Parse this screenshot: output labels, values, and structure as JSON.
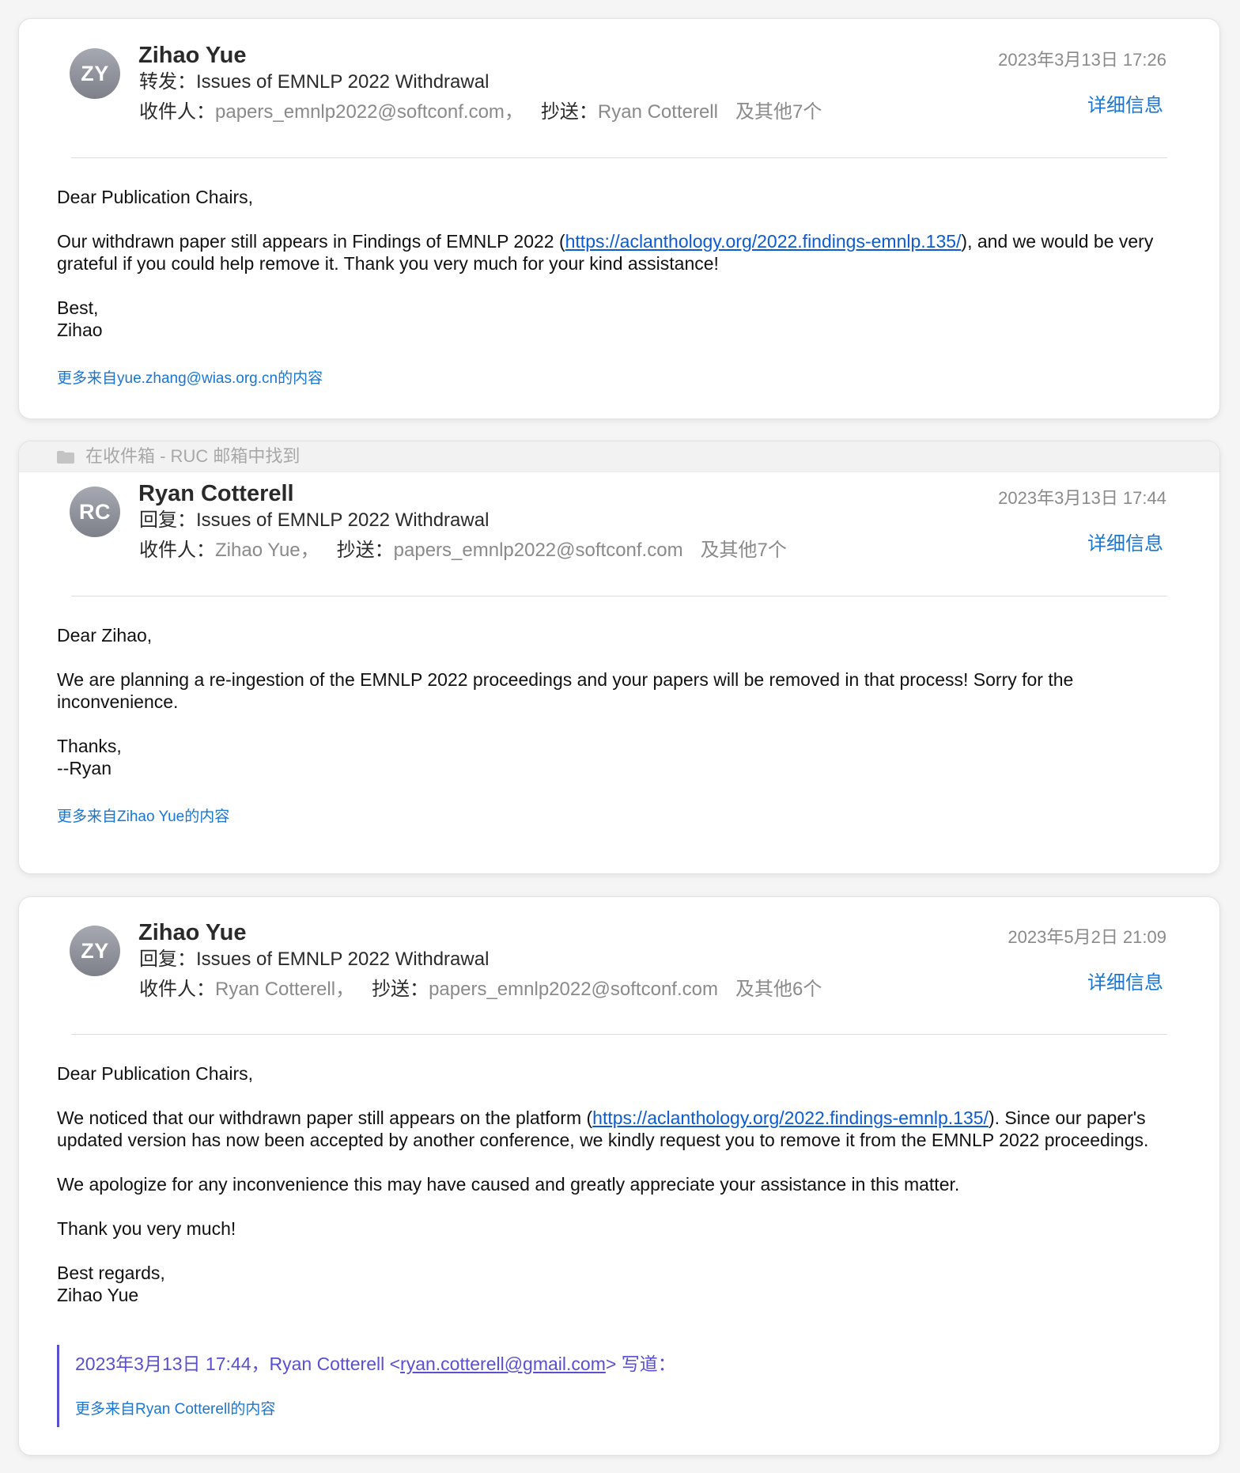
{
  "messages": [
    {
      "initials": "ZY",
      "sender": "Zihao Yue",
      "subject_prefix": "转发：",
      "subject": "Issues of EMNLP 2022 Withdrawal",
      "to_label": "收件人：",
      "to": "papers_emnlp2022@softconf.com，",
      "cc_label": "抄送：",
      "cc": "Ryan Cotterell",
      "others": "及其他7个",
      "date": "2023年3月13日 17:26",
      "details": "详细信息",
      "greeting": "Dear Publication Chairs,",
      "para1_before": "Our withdrawn paper still appears in Findings of EMNLP 2022 (",
      "link": "https://aclanthology.org/2022.findings-emnlp.135/",
      "para1_after": "), and we would be very grateful if you could help remove it. Thank you very much for your kind assistance!",
      "closing": "Best,",
      "signature": "Zihao",
      "more": "更多来自yue.zhang@wias.org.cn的内容"
    },
    {
      "found_in": "在收件箱 - RUC 邮箱中找到",
      "initials": "RC",
      "sender": "Ryan Cotterell",
      "subject_prefix": "回复：",
      "subject": "Issues of EMNLP 2022 Withdrawal",
      "to_label": "收件人：",
      "to": "Zihao Yue，",
      "cc_label": "抄送：",
      "cc": "papers_emnlp2022@softconf.com",
      "others": "及其他7个",
      "date": "2023年3月13日 17:44",
      "details": "详细信息",
      "greeting": "Dear Zihao,",
      "para1": "We are planning a re-ingestion of the EMNLP 2022 proceedings and your papers will be removed in that process! Sorry for the inconvenience.",
      "closing": "Thanks,",
      "signature": "--Ryan",
      "more": "更多来自Zihao Yue的内容"
    },
    {
      "initials": "ZY",
      "sender": "Zihao Yue",
      "subject_prefix": "回复：",
      "subject": "Issues of EMNLP 2022 Withdrawal",
      "to_label": "收件人：",
      "to": "Ryan Cotterell，",
      "cc_label": "抄送：",
      "cc": "papers_emnlp2022@softconf.com",
      "others": "及其他6个",
      "date": "2023年5月2日 21:09",
      "details": "详细信息",
      "greeting": "Dear Publication Chairs,",
      "para1_before": "We noticed that our withdrawn paper still appears on the platform (",
      "link": "https://aclanthology.org/2022.findings-emnlp.135/",
      "para1_after": "). Since our paper's updated version has now been accepted by another conference, we kindly request you to remove it from the EMNLP 2022 proceedings.",
      "para2": "We apologize for any inconvenience this may have caused and greatly appreciate your assistance in this matter.",
      "para3": "Thank you very much!",
      "closing": "Best regards,",
      "signature": "Zihao Yue",
      "quote_before": "2023年3月13日 17:44，Ryan Cotterell <",
      "quote_email": "ryan.cotterell@gmail.com",
      "quote_after": "> 写道：",
      "quote_more": "更多来自Ryan Cotterell的内容"
    }
  ]
}
